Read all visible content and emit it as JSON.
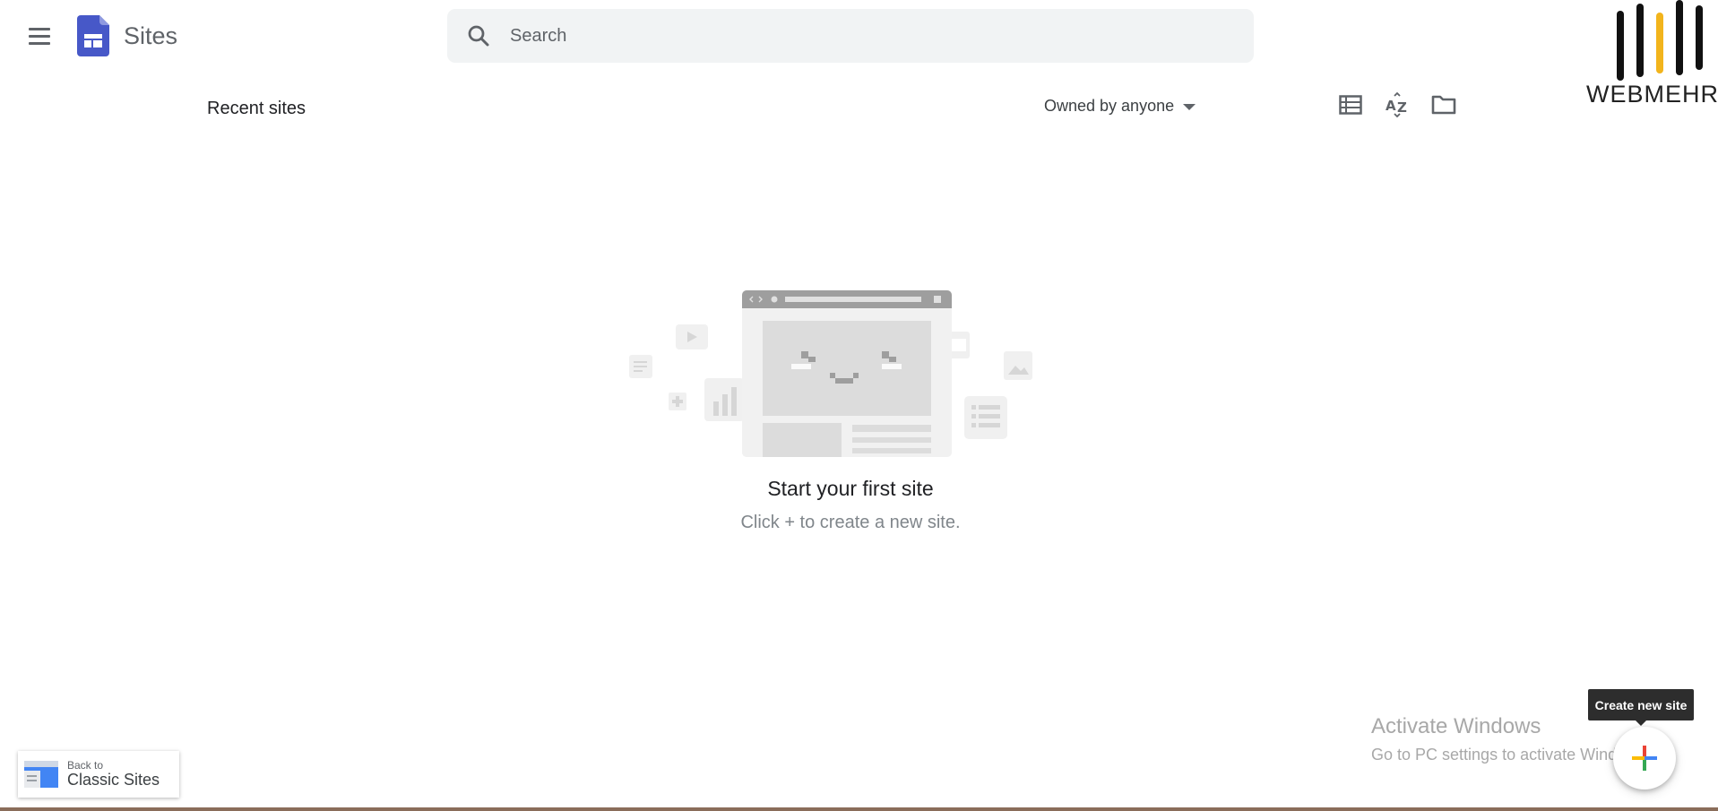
{
  "header": {
    "app_name": "Sites",
    "search_placeholder": "Search"
  },
  "brand": {
    "text": "WEBMEHR;",
    "accent_color": "#f2b41c"
  },
  "toolbar": {
    "recent_title": "Recent sites",
    "owner_filter": "Owned by anyone"
  },
  "empty_state": {
    "title": "Start your first site",
    "subtitle": "Click + to create a new site."
  },
  "watermark": {
    "title": "Activate Windows",
    "subtitle": "Go to PC settings to activate Windows."
  },
  "fab": {
    "tooltip": "Create new site"
  },
  "classic": {
    "small_label": "Back to",
    "big_label": "Classic Sites"
  },
  "colors": {
    "sites_logo": "#4758c8",
    "plus_red": "#ea4335",
    "plus_blue": "#4285f4",
    "plus_yellow": "#fbbc05",
    "plus_green": "#34a853"
  }
}
